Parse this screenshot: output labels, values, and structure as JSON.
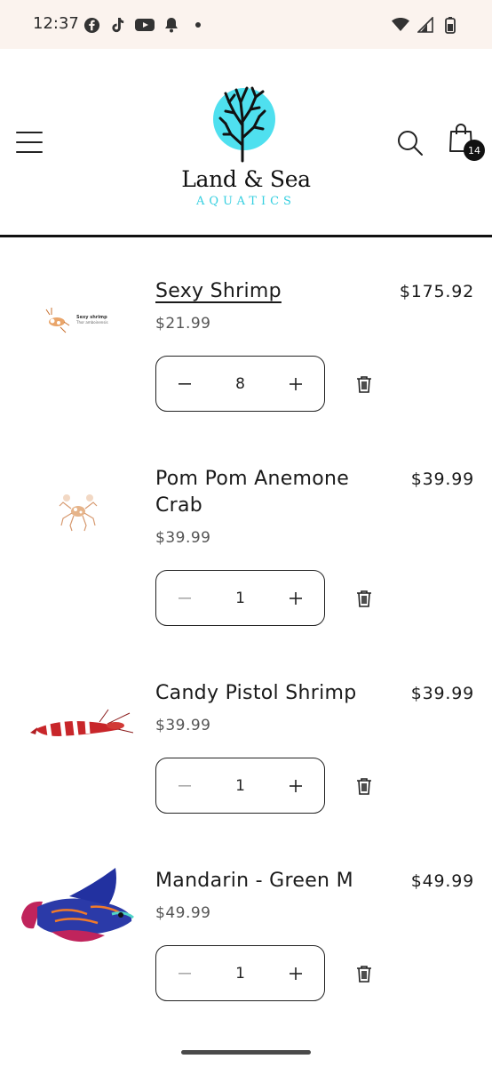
{
  "status_bar": {
    "time": "12:37",
    "left_icons": [
      "facebook-icon",
      "tiktok-icon",
      "youtube-icon",
      "notification-bell-icon",
      "dot-icon"
    ],
    "right_icons": [
      "wifi-icon",
      "signal-icon",
      "battery-icon"
    ]
  },
  "header": {
    "logo_title": "Land & Sea",
    "logo_subtitle": "AQUATICS",
    "cart_count": "14",
    "colors": {
      "logo_circle": "#4fe0ef",
      "logo_subtitle": "#35cfe0"
    }
  },
  "items": [
    {
      "title": "Sexy Shrimp",
      "unit_price": "$21.99",
      "total": "$175.92",
      "quantity": "8",
      "image_icon": "sexy-shrimp-image",
      "image_caption_1": "Sexy shrimp",
      "image_caption_2": "Thor amboinensis"
    },
    {
      "title": "Pom Pom Anemone Crab",
      "unit_price": "$39.99",
      "total": "$39.99",
      "quantity": "1",
      "image_icon": "pom-pom-crab-image"
    },
    {
      "title": "Candy Pistol Shrimp",
      "unit_price": "$39.99",
      "total": "$39.99",
      "quantity": "1",
      "image_icon": "candy-pistol-shrimp-image"
    },
    {
      "title": "Mandarin - Green M",
      "unit_price": "$49.99",
      "total": "$49.99",
      "quantity": "1",
      "image_icon": "mandarin-fish-image"
    }
  ]
}
